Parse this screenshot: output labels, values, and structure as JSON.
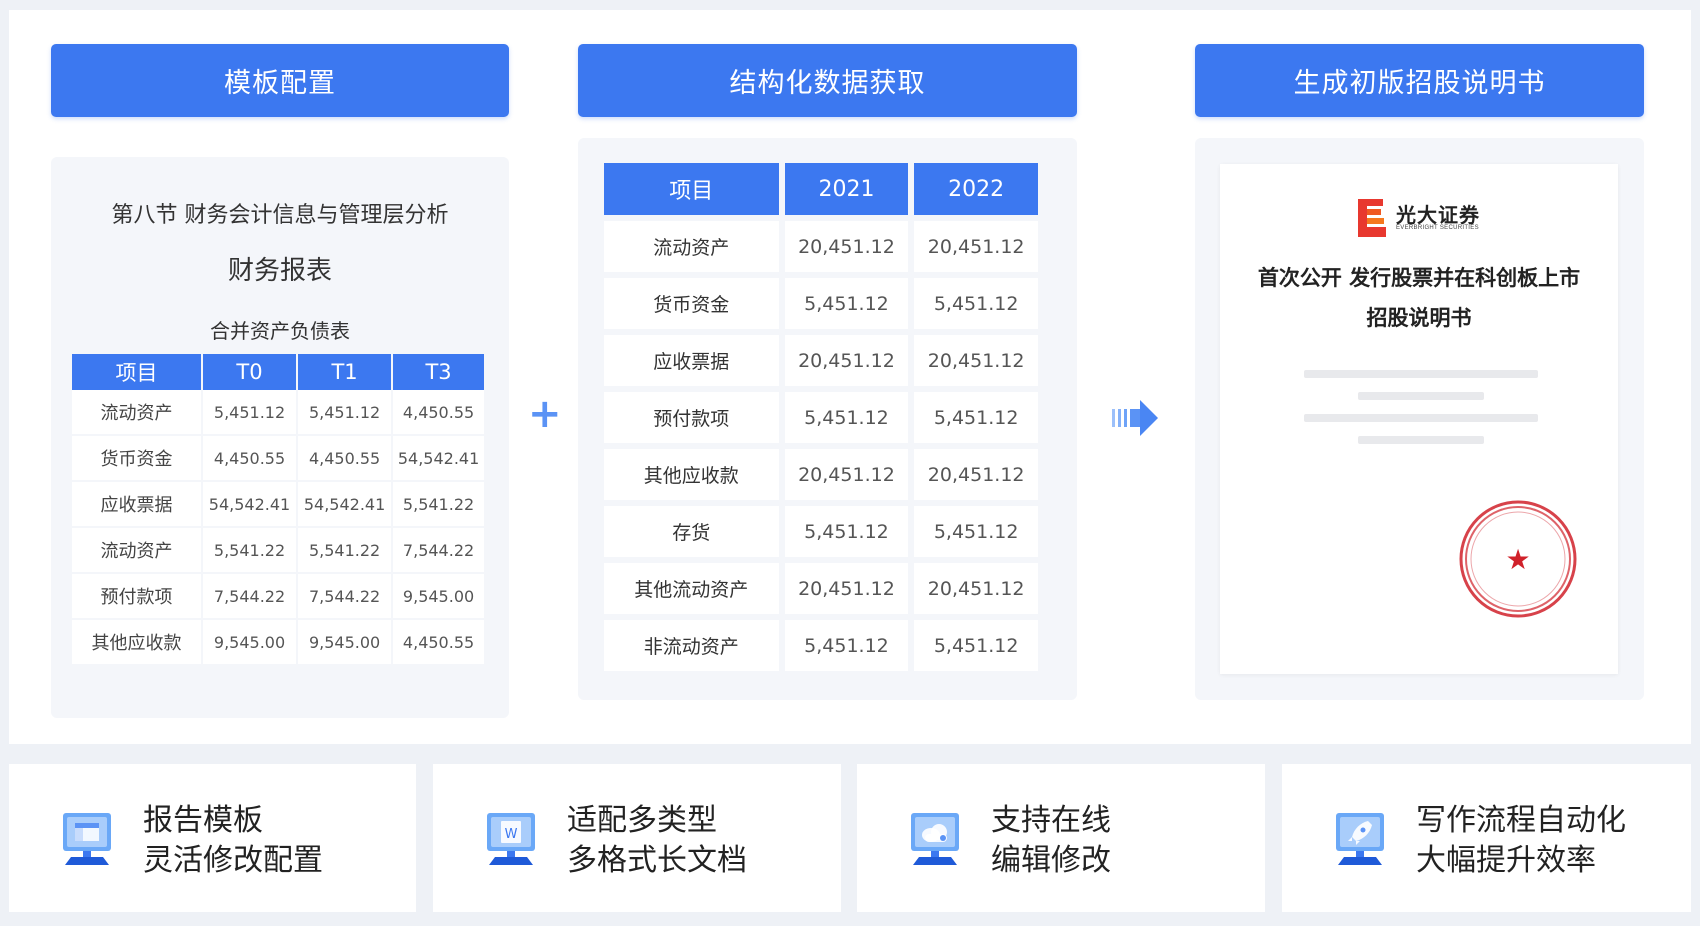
{
  "colors": {
    "accent": "#3c78f0",
    "panel_bg": "#f4f6fa",
    "seal_red": "#d0212a"
  },
  "headers": [
    "模板配置",
    "结构化数据获取",
    "生成初版招股说明书"
  ],
  "panel1": {
    "section": "第八节 财务会计信息与管理层分析",
    "title": "财务报表",
    "subtitle": "合并资产负债表",
    "table": {
      "columns": [
        "项目",
        "T0",
        "T1",
        "T3"
      ],
      "rows": [
        [
          "流动资产",
          "5,451.12",
          "5,451.12",
          "4,450.55"
        ],
        [
          "货币资金",
          "4,450.55",
          "4,450.55",
          "54,542.41"
        ],
        [
          "应收票据",
          "54,542.41",
          "54,542.41",
          "5,541.22"
        ],
        [
          "流动资产",
          "5,541.22",
          "5,541.22",
          "7,544.22"
        ],
        [
          "预付款项",
          "7,544.22",
          "7,544.22",
          "9,545.00"
        ],
        [
          "其他应收款",
          "9,545.00",
          "9,545.00",
          "4,450.55"
        ]
      ]
    }
  },
  "panel2": {
    "table": {
      "columns": [
        "项目",
        "2021",
        "2022"
      ],
      "rows": [
        [
          "流动资产",
          "20,451.12",
          "20,451.12"
        ],
        [
          "货币资金",
          "5,451.12",
          "5,451.12"
        ],
        [
          "应收票据",
          "20,451.12",
          "20,451.12"
        ],
        [
          "预付款项",
          "5,451.12",
          "5,451.12"
        ],
        [
          "其他应收款",
          "20,451.12",
          "20,451.12"
        ],
        [
          "存货",
          "5,451.12",
          "5,451.12"
        ],
        [
          "其他流动资产",
          "20,451.12",
          "20,451.12"
        ],
        [
          "非流动资产",
          "5,451.12",
          "5,451.12"
        ]
      ]
    }
  },
  "panel3": {
    "logo_name": "光大证券",
    "logo_en": "EVERBRIGHT SECURITIES",
    "doc_title_line1": "首次公开 发行股票并在科创板上市",
    "doc_title_line2": "招股说明书",
    "seal_star": "★"
  },
  "plus_symbol": "+",
  "cards": [
    {
      "icon": "template-monitor-icon",
      "line1": "报告模板",
      "line2": "灵活修改配置"
    },
    {
      "icon": "word-document-monitor-icon",
      "line1": "适配多类型",
      "line2": "多格式长文档"
    },
    {
      "icon": "cloud-edit-monitor-icon",
      "line1": "支持在线",
      "line2": "编辑修改"
    },
    {
      "icon": "rocket-monitor-icon",
      "line1": "写作流程自动化",
      "line2": "大幅提升效率"
    }
  ]
}
